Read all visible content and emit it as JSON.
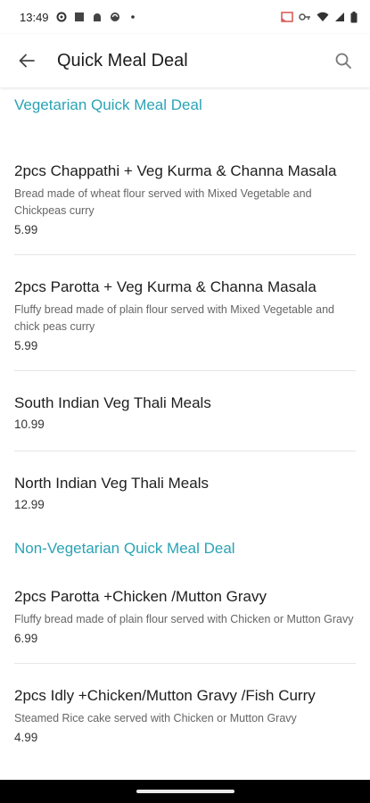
{
  "status_bar": {
    "time": "13:49"
  },
  "app_bar": {
    "title": "Quick Meal Deal"
  },
  "sections": [
    {
      "title": "Vegetarian Quick Meal Deal",
      "items": [
        {
          "name": "2pcs Chappathi + Veg Kurma & Channa Masala",
          "description": "Bread made of wheat flour served with Mixed Vegetable and Chickpeas curry",
          "price": "5.99"
        },
        {
          "name": "2pcs Parotta + Veg Kurma & Channa Masala",
          "description": "Fluffy bread made of plain flour served with Mixed Vegetable and chick peas curry",
          "price": "5.99"
        },
        {
          "name": "South Indian Veg Thali Meals",
          "description": "",
          "price": "10.99"
        },
        {
          "name": "North Indian Veg Thali Meals",
          "description": "",
          "price": "12.99"
        }
      ]
    },
    {
      "title": "Non-Vegetarian Quick Meal Deal",
      "items": [
        {
          "name": "2pcs Parotta +Chicken /Mutton Gravy",
          "description": "Fluffy bread made of plain flour served with Chicken or Mutton Gravy",
          "price": "6.99"
        },
        {
          "name": "2pcs Idly +Chicken/Mutton Gravy /Fish Curry",
          "description": "Steamed Rice cake served with Chicken or Mutton Gravy",
          "price": "4.99"
        }
      ]
    }
  ],
  "colors": {
    "section_header": "#2aa3b5",
    "divider": "#e6e6e6"
  },
  "icons": [
    "arrow-back-icon",
    "search-icon",
    "wifi-icon",
    "battery-icon",
    "signal-icon"
  ]
}
